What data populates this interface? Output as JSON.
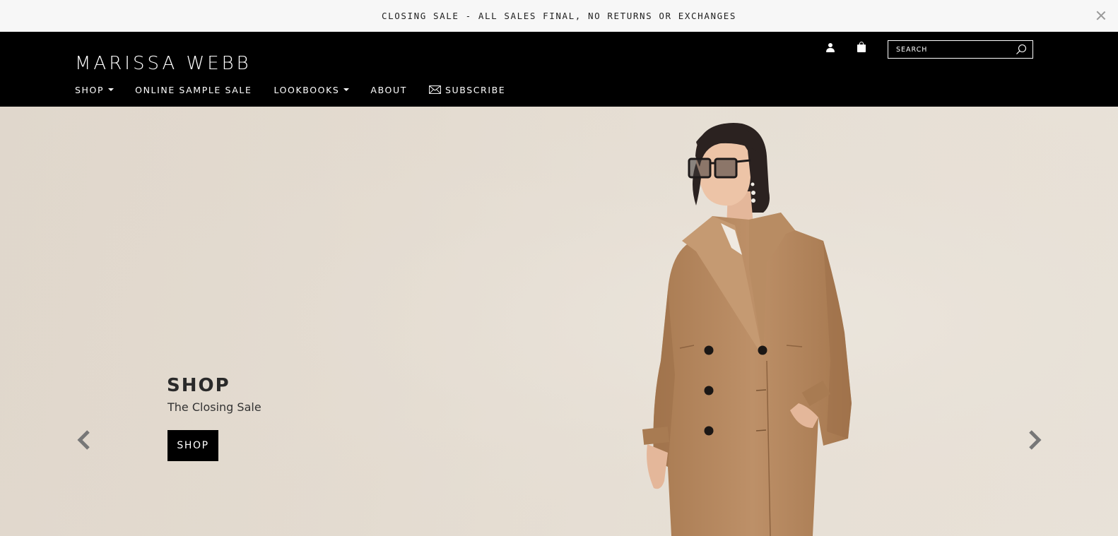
{
  "announcement": {
    "text": "CLOSING SALE - ALL SALES FINAL, NO RETURNS OR EXCHANGES",
    "close_icon": "close-icon"
  },
  "header": {
    "logo": "MARISSA WEBB",
    "utility": {
      "account_icon": "user-icon",
      "cart_icon": "shopping-bag-icon",
      "search_placeholder": "SEARCH",
      "search_icon": "search-icon"
    },
    "nav": [
      {
        "label": "SHOP",
        "dropdown": true
      },
      {
        "label": "ONLINE SAMPLE SALE",
        "dropdown": false
      },
      {
        "label": "LOOKBOOKS",
        "dropdown": true
      },
      {
        "label": "ABOUT",
        "dropdown": false
      },
      {
        "label": "SUBSCRIBE",
        "dropdown": false,
        "icon": "envelope-icon"
      }
    ]
  },
  "hero": {
    "title": "SHOP",
    "subtitle": "The Closing Sale",
    "button_label": "SHOP",
    "prev_icon": "chevron-left-icon",
    "next_icon": "chevron-right-icon"
  },
  "colors": {
    "header_bg": "#000000",
    "announcement_bg": "#f7f7f7",
    "hero_bg": "#e6ded4",
    "coat": "#b78a60"
  }
}
